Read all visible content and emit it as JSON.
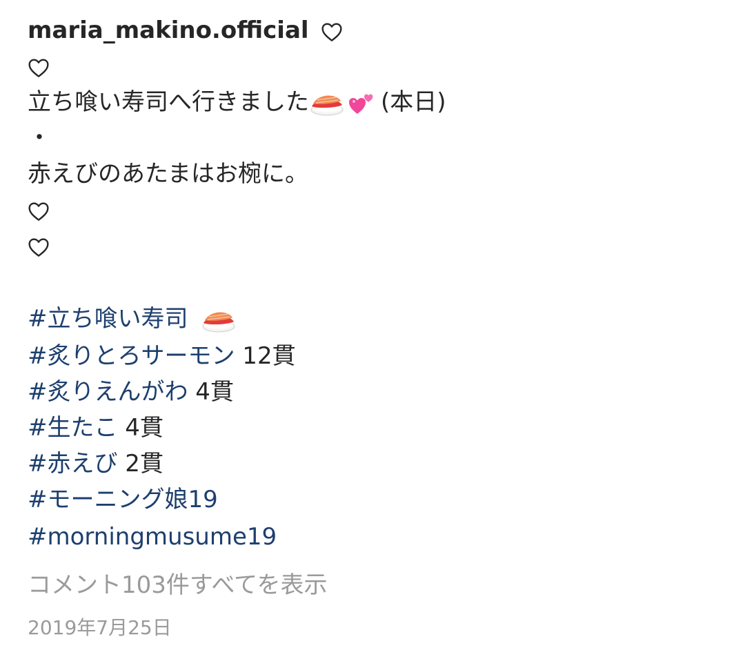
{
  "post": {
    "username": "maria_makino.official",
    "caption": {
      "line3_text": "立ち喰い寿司へ行きました",
      "line3_suffix": "(本日)",
      "line4": "・",
      "line5": "赤えびのあたまはお椀に。"
    },
    "hashtags": [
      {
        "tag": "#立ち喰い寿司",
        "suffix": ""
      },
      {
        "tag": "#炙りとろサーモン",
        "suffix": " 12貫"
      },
      {
        "tag": "#炙りえんがわ",
        "suffix": " 4貫"
      },
      {
        "tag": "#生たこ",
        "suffix": " 4貫"
      },
      {
        "tag": "#赤えび",
        "suffix": " 2貫"
      },
      {
        "tag": "#モーニング娘19",
        "suffix": ""
      },
      {
        "tag": "#morningmusume19",
        "suffix": ""
      }
    ],
    "view_comments": "コメント103件すべてを表示",
    "date": "2019年7月25日"
  },
  "icons": {
    "heart": "heart-outline-icon",
    "sushi": "sushi-emoji-icon",
    "two_hearts": "two-hearts-emoji-icon"
  },
  "colors": {
    "text": "#262626",
    "hashtag": "#1d3f6e",
    "muted": "#9a9a9a",
    "background": "#ffffff"
  }
}
